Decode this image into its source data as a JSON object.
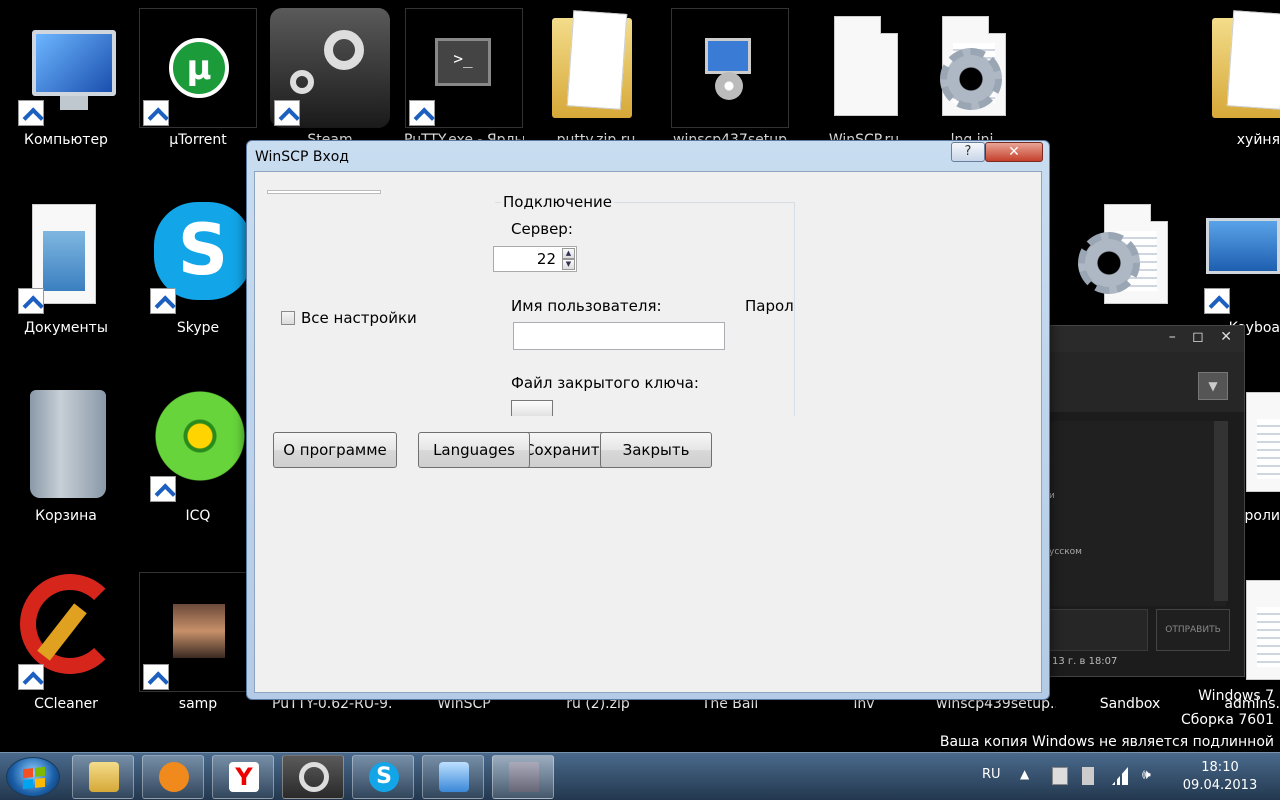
{
  "desktop": {
    "icons": [
      {
        "label": "Компьютер"
      },
      {
        "label": "µTorrent"
      },
      {
        "label": "Steam"
      },
      {
        "label": "PuTTY.exe - Ярлык"
      },
      {
        "label": "putty.zip.ru"
      },
      {
        "label": "winscp437setup"
      },
      {
        "label": "WinSCP.ru"
      },
      {
        "label": "lng.ini"
      },
      {
        "label": "хуйня"
      },
      {
        "label": "Документы"
      },
      {
        "label": "Skype"
      },
      {
        "label": "Корзина"
      },
      {
        "label": "ICQ"
      },
      {
        "label": "CCleaner"
      },
      {
        "label": "samp"
      },
      {
        "label": "PuTTY-0.62-RU-9...."
      },
      {
        "label": "WinSCP"
      },
      {
        "label": "ru (2).zip"
      },
      {
        "label": "The Ball"
      },
      {
        "label": "inv"
      },
      {
        "label": "winscp439setup...."
      },
      {
        "label": "Sandbox"
      },
      {
        "label": "admins."
      },
      {
        "label": "Keyboa"
      },
      {
        "label": "пароли"
      }
    ]
  },
  "watermark": {
    "line1": "Windows 7",
    "line2": "Сборка 7601",
    "line3": "Ваша копия Windows не является подлинной"
  },
  "chat": {
    "controls": "– ◻ ✕",
    "dropdown_icon": "▼",
    "msg1": "и",
    "msg2": "усском",
    "send_label": "ОТПРАВИТЬ",
    "date": "13 г. в 18:07"
  },
  "dialog": {
    "title": "WinSCP Вход",
    "help_label": "?",
    "close_label": "✕",
    "all_settings_label": "Все настройки",
    "group_title": "Подключение",
    "server_label": "Сервер:",
    "port_value": "22",
    "username_label": "Имя пользователя:",
    "password_label": "Пароль:",
    "username_value": "",
    "private_key_label": "Файл закрытого ключа:",
    "buttons": {
      "about": "О программе",
      "save": "Сохранить",
      "languages": "Languages",
      "close": "Закрыть"
    }
  },
  "taskbar": {
    "lang": "RU",
    "tray_arrow": "▲",
    "time": "18:10",
    "date": "09.04.2013"
  },
  "colors": {
    "desktop_bg": "#000000",
    "dialog_frame": "#b9d1ea",
    "dialog_client": "#f0f0f0",
    "taskbar": "#2c4560"
  }
}
